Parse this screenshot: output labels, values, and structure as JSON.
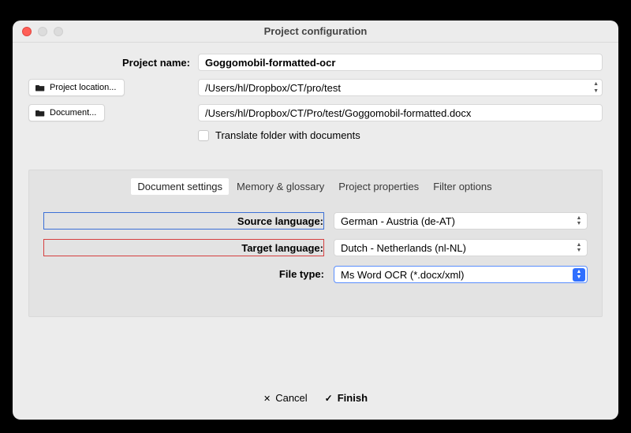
{
  "window": {
    "title": "Project configuration"
  },
  "fields": {
    "project_name_label": "Project name:",
    "project_name_value": "Goggomobil-formatted-ocr",
    "project_location_btn": "Project location...",
    "project_location_value": "/Users/hl/Dropbox/CT/pro/test",
    "document_btn": "Document...",
    "document_value": "/Users/hl/Dropbox/CT/Pro/test/Goggomobil-formatted.docx",
    "translate_folder_label": "Translate folder with documents"
  },
  "tabs": {
    "t0": "Document settings",
    "t1": "Memory & glossary",
    "t2": "Project properties",
    "t3": "Filter options"
  },
  "settings": {
    "source_lang_label": "Source language:",
    "source_lang_value": "German - Austria (de-AT)",
    "target_lang_label": "Target language:",
    "target_lang_value": "Dutch - Netherlands (nl-NL)",
    "file_type_label": "File type:",
    "file_type_value": "Ms Word OCR (*.docx/xml)"
  },
  "footer": {
    "cancel": "Cancel",
    "finish": "Finish"
  }
}
